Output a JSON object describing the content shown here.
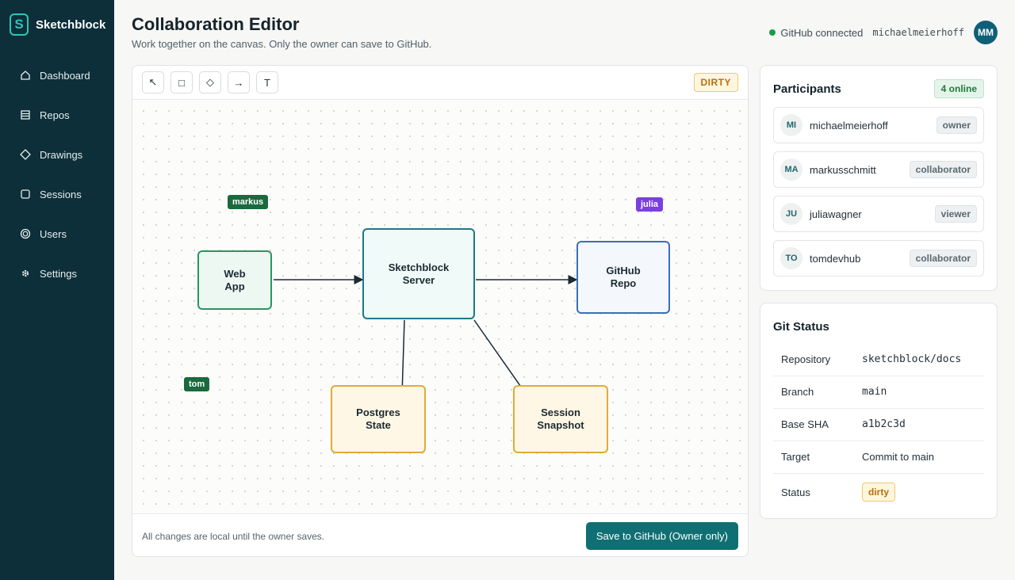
{
  "brand": {
    "logo_letter": "S",
    "name": "Sketchblock"
  },
  "sidebar": {
    "items": [
      {
        "label": "Dashboard",
        "icon": "home-icon"
      },
      {
        "label": "Repos",
        "icon": "repos-icon"
      },
      {
        "label": "Drawings",
        "icon": "diamond-icon"
      },
      {
        "label": "Sessions",
        "icon": "square-icon"
      },
      {
        "label": "Users",
        "icon": "users-icon"
      },
      {
        "label": "Settings",
        "icon": "gear-icon"
      }
    ]
  },
  "header": {
    "title": "Collaboration Editor",
    "subtitle": "Work together on the canvas. Only the owner can save to GitHub.",
    "connection_status": "GitHub connected",
    "username": "michaelmeierhoff",
    "avatar_initials": "MM"
  },
  "toolbar": {
    "tools": [
      {
        "name": "select-tool",
        "glyph": "↖"
      },
      {
        "name": "rectangle-tool",
        "glyph": "□"
      },
      {
        "name": "diamond-tool",
        "glyph": "◇"
      },
      {
        "name": "arrow-tool",
        "glyph": "→"
      },
      {
        "name": "text-tool",
        "glyph": "T"
      }
    ],
    "dirty_label": "DIRTY"
  },
  "canvas": {
    "nodes": {
      "web_app": "Web\nApp",
      "server": "Sketchblock\nServer",
      "github": "GitHub\nRepo",
      "postgres": "Postgres\nState",
      "snapshot": "Session\nSnapshot"
    },
    "cursors": {
      "markus": "markus",
      "julia": "julia",
      "tom": "tom"
    },
    "colors": {
      "cursor_green": "#1a6a3e",
      "cursor_purple": "#7b3fe0"
    }
  },
  "footer": {
    "note": "All changes are local until the owner saves.",
    "save_label": "Save to GitHub (Owner only)"
  },
  "participants": {
    "title": "Participants",
    "online_badge": "4 online",
    "list": [
      {
        "initials": "MI",
        "name": "michaelmeierhoff",
        "role": "owner"
      },
      {
        "initials": "MA",
        "name": "markusschmitt",
        "role": "collaborator"
      },
      {
        "initials": "JU",
        "name": "juliawagner",
        "role": "viewer"
      },
      {
        "initials": "TO",
        "name": "tomdevhub",
        "role": "collaborator"
      }
    ]
  },
  "git_status": {
    "title": "Git Status",
    "rows": [
      {
        "key": "Repository",
        "value": "sketchblock/docs"
      },
      {
        "key": "Branch",
        "value": "main"
      },
      {
        "key": "Base SHA",
        "value": "a1b2c3d"
      },
      {
        "key": "Target",
        "value": "Commit to main"
      },
      {
        "key": "Status",
        "value": "dirty"
      }
    ]
  },
  "theme": {
    "accent": "#106f73",
    "sidebar_bg": "#0d2f3a",
    "dirty": "#b7700a"
  }
}
